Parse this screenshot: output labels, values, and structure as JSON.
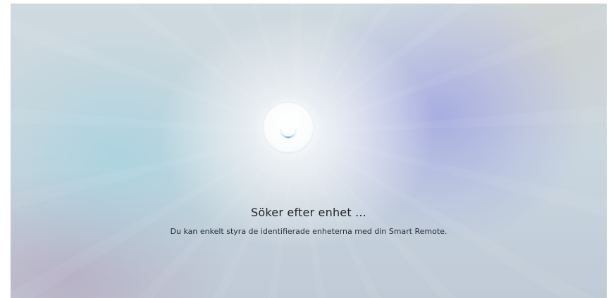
{
  "screen": {
    "status_title": "Söker efter enhet ...",
    "status_description": "Du kan enkelt styra de identifierade enheterna med din Smart Remote.",
    "spinner_icon": "loading-spinner-icon"
  },
  "colors": {
    "accent_spinner": "#6fb6e8",
    "text_primary": "#1f2227",
    "text_secondary": "#2a2e35"
  }
}
